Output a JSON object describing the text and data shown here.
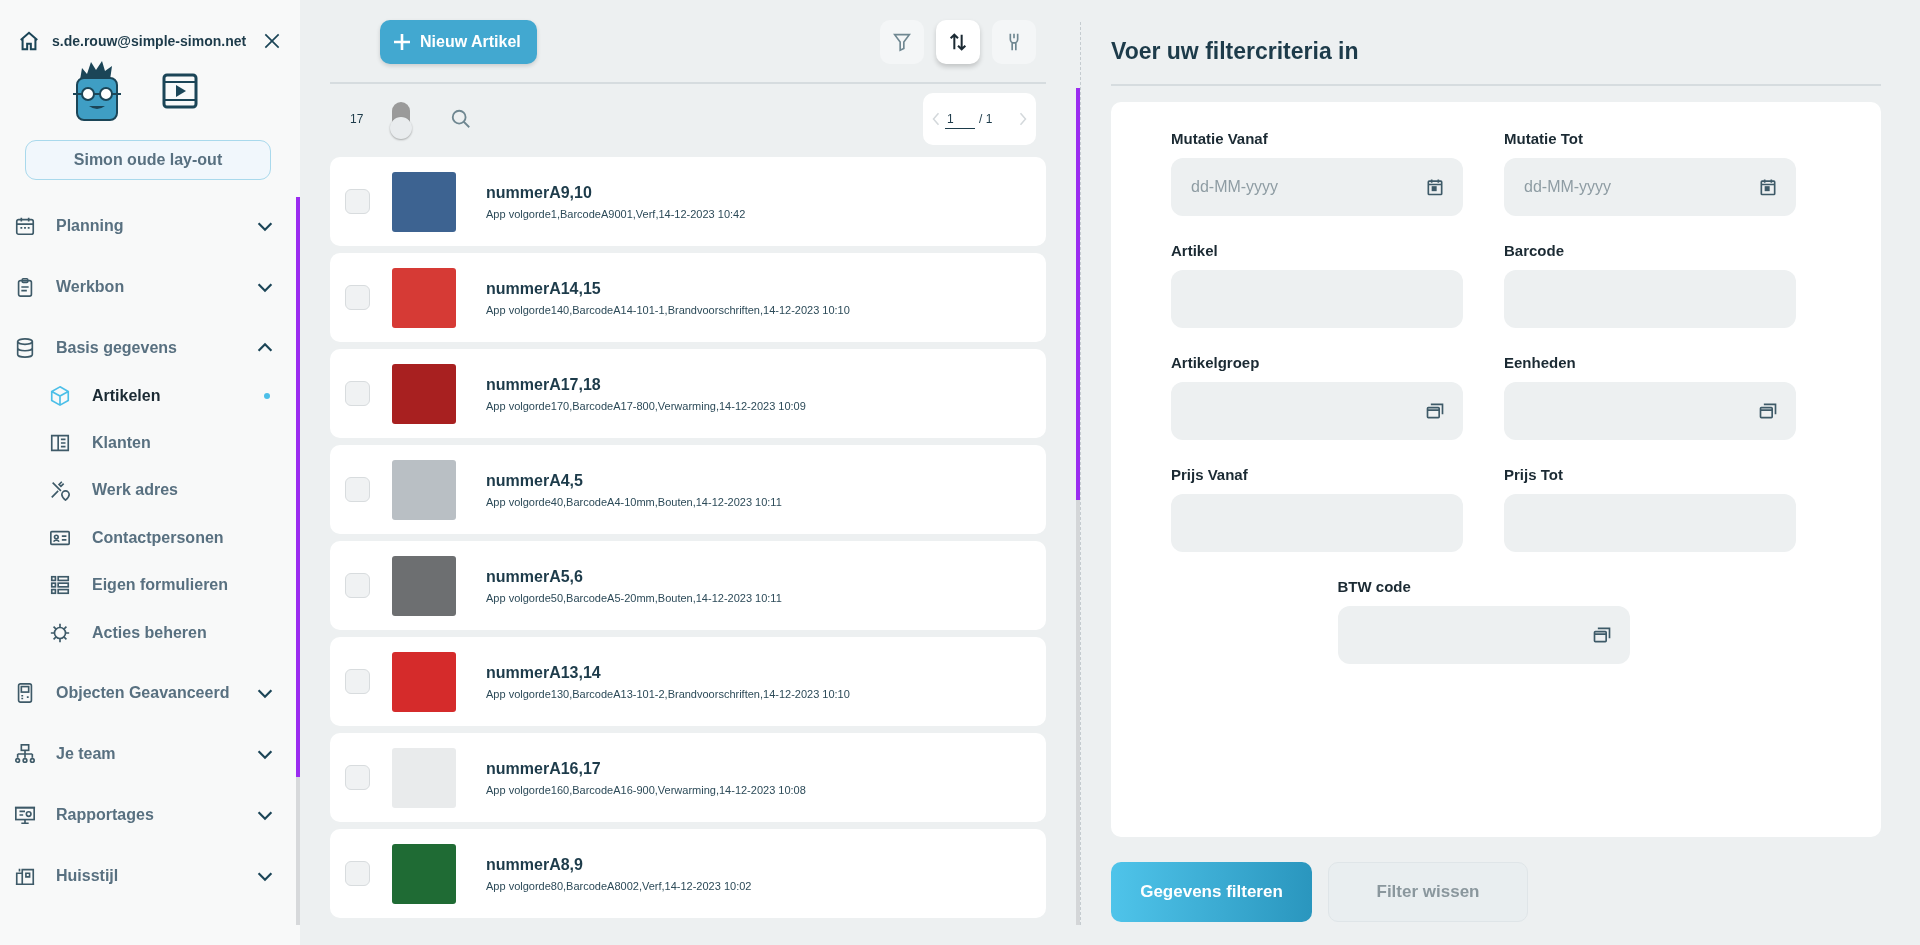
{
  "sidebar": {
    "user_email": "s.de.rouw@simple-simon.net",
    "layout_button": "Simon oude lay-out",
    "nav": [
      {
        "label": "Planning",
        "expanded": false
      },
      {
        "label": "Werkbon",
        "expanded": false
      },
      {
        "label": "Basis gegevens",
        "expanded": true,
        "children": [
          {
            "label": "Artikelen",
            "selected": true
          },
          {
            "label": "Klanten",
            "selected": false
          },
          {
            "label": "Werk adres",
            "selected": false
          },
          {
            "label": "Contactpersonen",
            "selected": false
          },
          {
            "label": "Eigen formulieren",
            "selected": false
          },
          {
            "label": "Acties beheren",
            "selected": false
          }
        ]
      },
      {
        "label": "Objecten Geavanceerd",
        "expanded": false
      },
      {
        "label": "Je team",
        "expanded": false
      },
      {
        "label": "Rapportages",
        "expanded": false
      },
      {
        "label": "Huisstijl",
        "expanded": false
      }
    ]
  },
  "toolbar": {
    "new_button": "Nieuw Artikel",
    "tools": [
      {
        "selected": false
      },
      {
        "selected": true
      },
      {
        "selected": false
      }
    ]
  },
  "list_header": {
    "count": "17",
    "toggle_on": false,
    "page": "1",
    "page_total": "/ 1"
  },
  "articles": [
    {
      "title": "nummerA9,10",
      "details": "App volgorde1,BarcodeA9001,Verf,14-12-2023 10:42",
      "checked": false
    },
    {
      "title": "nummerA14,15",
      "details": "App volgorde140,BarcodeA14-101-1,Brandvoorschriften,14-12-2023 10:10",
      "checked": false
    },
    {
      "title": "nummerA17,18",
      "details": "App volgorde170,BarcodeA17-800,Verwarming,14-12-2023 10:09",
      "checked": false
    },
    {
      "title": "nummerA4,5",
      "details": "App volgorde40,BarcodeA4-10mm,Bouten,14-12-2023 10:11",
      "checked": false
    },
    {
      "title": "nummerA5,6",
      "details": "App volgorde50,BarcodeA5-20mm,Bouten,14-12-2023 10:11",
      "checked": false
    },
    {
      "title": "nummerA13,14",
      "details": "App volgorde130,BarcodeA13-101-2,Brandvoorschriften,14-12-2023 10:10",
      "checked": false
    },
    {
      "title": "nummerA16,17",
      "details": "App volgorde160,BarcodeA16-900,Verwarming,14-12-2023 10:08",
      "checked": false
    },
    {
      "title": "nummerA8,9",
      "details": "App volgorde80,BarcodeA8002,Verf,14-12-2023 10:02",
      "checked": false
    }
  ],
  "filter_panel": {
    "title": "Voer uw filtercriteria in",
    "fields": [
      {
        "label": "Mutatie Vanaf",
        "kind": "date",
        "placeholder": "dd-MM-yyyy"
      },
      {
        "label": "Mutatie Tot",
        "kind": "date",
        "placeholder": "dd-MM-yyyy"
      },
      {
        "label": "Artikel",
        "kind": "text"
      },
      {
        "label": "Barcode",
        "kind": "text"
      },
      {
        "label": "Artikelgroep",
        "kind": "lookup"
      },
      {
        "label": "Eenheden",
        "kind": "lookup"
      },
      {
        "label": "Prijs Vanaf",
        "kind": "text"
      },
      {
        "label": "Prijs Tot",
        "kind": "text"
      },
      {
        "label": "BTW code",
        "kind": "lookup"
      }
    ],
    "apply_button": {
      "label": "Gegevens filteren",
      "disabled": false
    },
    "clear_button": {
      "label": "Filter wissen",
      "disabled": true
    }
  }
}
